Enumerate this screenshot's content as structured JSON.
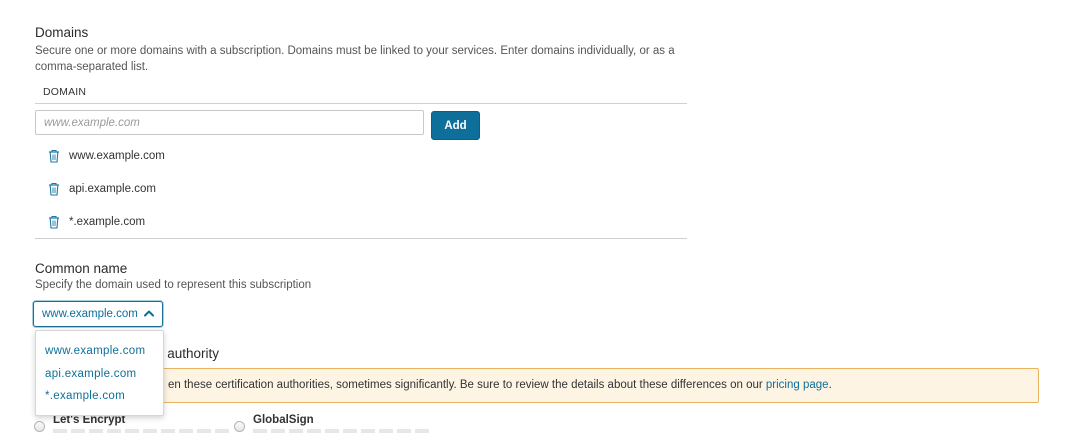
{
  "domains_section": {
    "title": "Domains",
    "description": "Secure one or more domains with a subscription. Domains must be linked to your services. Enter domains individually, or as a comma-separated list.",
    "column_header": "DOMAIN",
    "input_placeholder": "www.example.com",
    "add_label": "Add",
    "items": [
      {
        "label": "www.example.com"
      },
      {
        "label": "api.example.com"
      },
      {
        "label": "*.example.com"
      }
    ]
  },
  "common_name": {
    "title": "Common name",
    "description": "Specify the domain used to represent this subscription",
    "selected": "www.example.com",
    "options": [
      "www.example.com",
      "api.example.com",
      "*.example.com"
    ]
  },
  "certification_authority": {
    "title_visible": "n authority",
    "notice_text": "en these certification authorities, sometimes significantly. Be sure to review the details about these differences on our ",
    "notice_link": "pricing page",
    "notice_end": ".",
    "options": [
      {
        "label": "Let's Encrypt"
      },
      {
        "label": "GlobalSign"
      }
    ]
  },
  "colors": {
    "accent": "#0e6f9a",
    "notice_bg": "#fdf4e3",
    "notice_border": "#e9b35f"
  }
}
